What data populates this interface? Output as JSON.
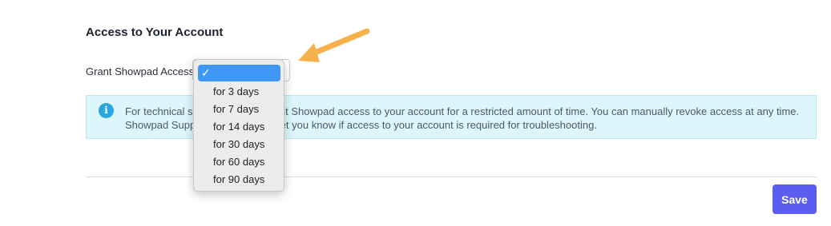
{
  "section": {
    "title": "Access to Your Account"
  },
  "grant": {
    "label": "Grant Showpad Access"
  },
  "dropdown": {
    "selected_label": "",
    "options": [
      "for 3 days",
      "for 7 days",
      "for 14 days",
      "for 30 days",
      "for 60 days",
      "for 90 days"
    ]
  },
  "info": {
    "text": "For technical support you can grant Showpad access to your account for a restricted amount of time. You can manually revoke access at any time. Showpad Support Engineers will let you know if access to your account is required for troubleshooting.",
    "icon": "info-icon"
  },
  "actions": {
    "save_label": "Save"
  },
  "colors": {
    "accent": "#5b5cf0",
    "info_background": "#dcf6fc",
    "selection": "#3f97f6",
    "arrow": "#f6b14a"
  }
}
